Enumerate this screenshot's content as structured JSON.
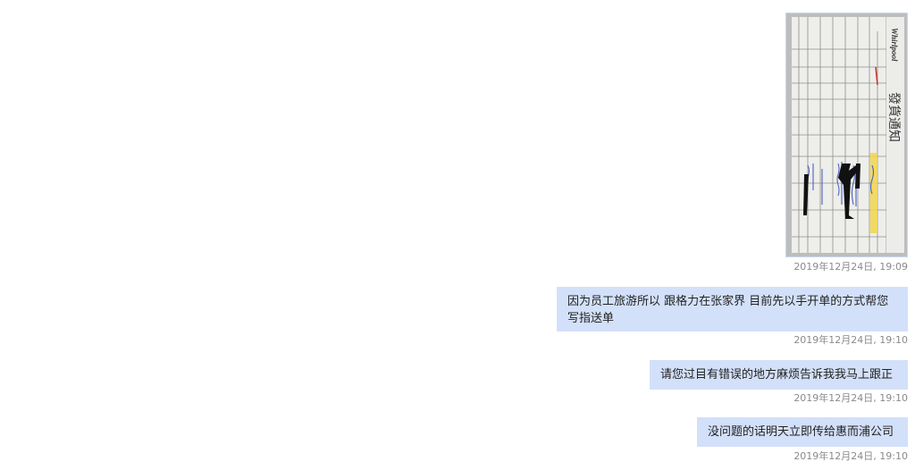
{
  "messages": [
    {
      "type": "image",
      "image": {
        "brand": "Whirlpool",
        "title": "發貨通知"
      },
      "timestamp": "2019年12月24日, 19:09"
    },
    {
      "type": "text",
      "text": "因为员工旅游所以 跟格力在张家界 目前先以手开单的方式帮您写指送单",
      "timestamp": "2019年12月24日, 19:10"
    },
    {
      "type": "text",
      "text": "请您过目有错误的地方麻烦告诉我我马上跟正",
      "timestamp": "2019年12月24日, 19:10"
    },
    {
      "type": "text",
      "text": "没问题的话明天立即传给惠而浦公司",
      "timestamp": "2019年12月24日, 19:10"
    }
  ],
  "colors": {
    "bubble": "#d3e0f9",
    "timestamp": "#8a8a8a",
    "background": "#ffffff"
  }
}
